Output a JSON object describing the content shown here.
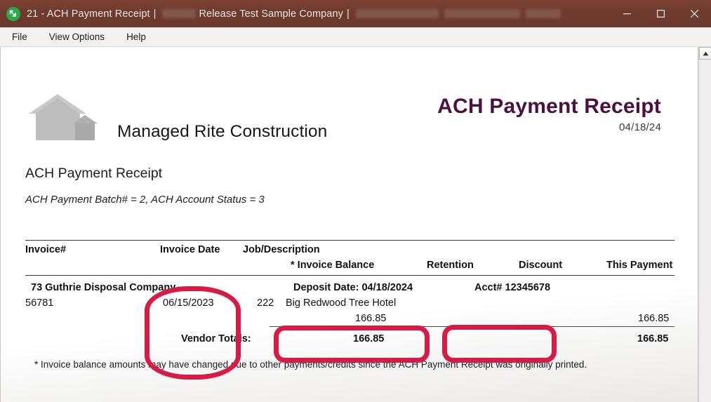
{
  "window": {
    "title_prefix": "21 - ACH Payment Receipt",
    "separator": "|",
    "company": "Release Test Sample Company",
    "icon": "app-logo-icon",
    "controls": {
      "minimize": "minimize-icon",
      "maximize": "maximize-icon",
      "close": "close-icon"
    }
  },
  "menu": {
    "items": [
      {
        "label": "File"
      },
      {
        "label": "View Options"
      },
      {
        "label": "Help"
      }
    ]
  },
  "document": {
    "company_name": "Managed Rite Construction",
    "logo": "building-logo-icon",
    "title": "ACH Payment Receipt",
    "title_date": "04/18/24",
    "subtitle": "ACH Payment Receipt",
    "meta_line": "ACH Payment Batch# = 2, ACH Account Status = 3",
    "footnote": "* Invoice balance amounts may have changed due to other payments/credits since the ACH Payment Receipt was originally printed."
  },
  "table": {
    "headers": {
      "invoice": "Invoice#",
      "invoice_date": "Invoice Date",
      "job_description": "Job/Description",
      "invoice_balance": "* Invoice Balance",
      "retention": "Retention",
      "discount": "Discount",
      "this_payment": "This Payment"
    },
    "row": {
      "vendor": "73  Guthrie Disposal Company",
      "invoice_number": "56781",
      "invoice_date": "06/15/2023",
      "job_number": "222",
      "job_description": "Big Redwood Tree Hotel",
      "deposit_date": "Deposit Date:  04/18/2024",
      "account": "Acct#  12345678",
      "invoice_balance": "166.85",
      "retention": "",
      "discount": "",
      "this_payment": "166.85"
    },
    "totals": {
      "label": "Vendor Totals:",
      "invoice_balance": "166.85",
      "this_payment": "166.85"
    }
  },
  "annotations": {
    "color": "#d81b45",
    "regions": [
      {
        "name": "invoice-date-column"
      },
      {
        "name": "deposit-date-field"
      },
      {
        "name": "account-number-field"
      }
    ]
  },
  "scrollbar": {
    "up_arrow": "scroll-up-icon"
  }
}
